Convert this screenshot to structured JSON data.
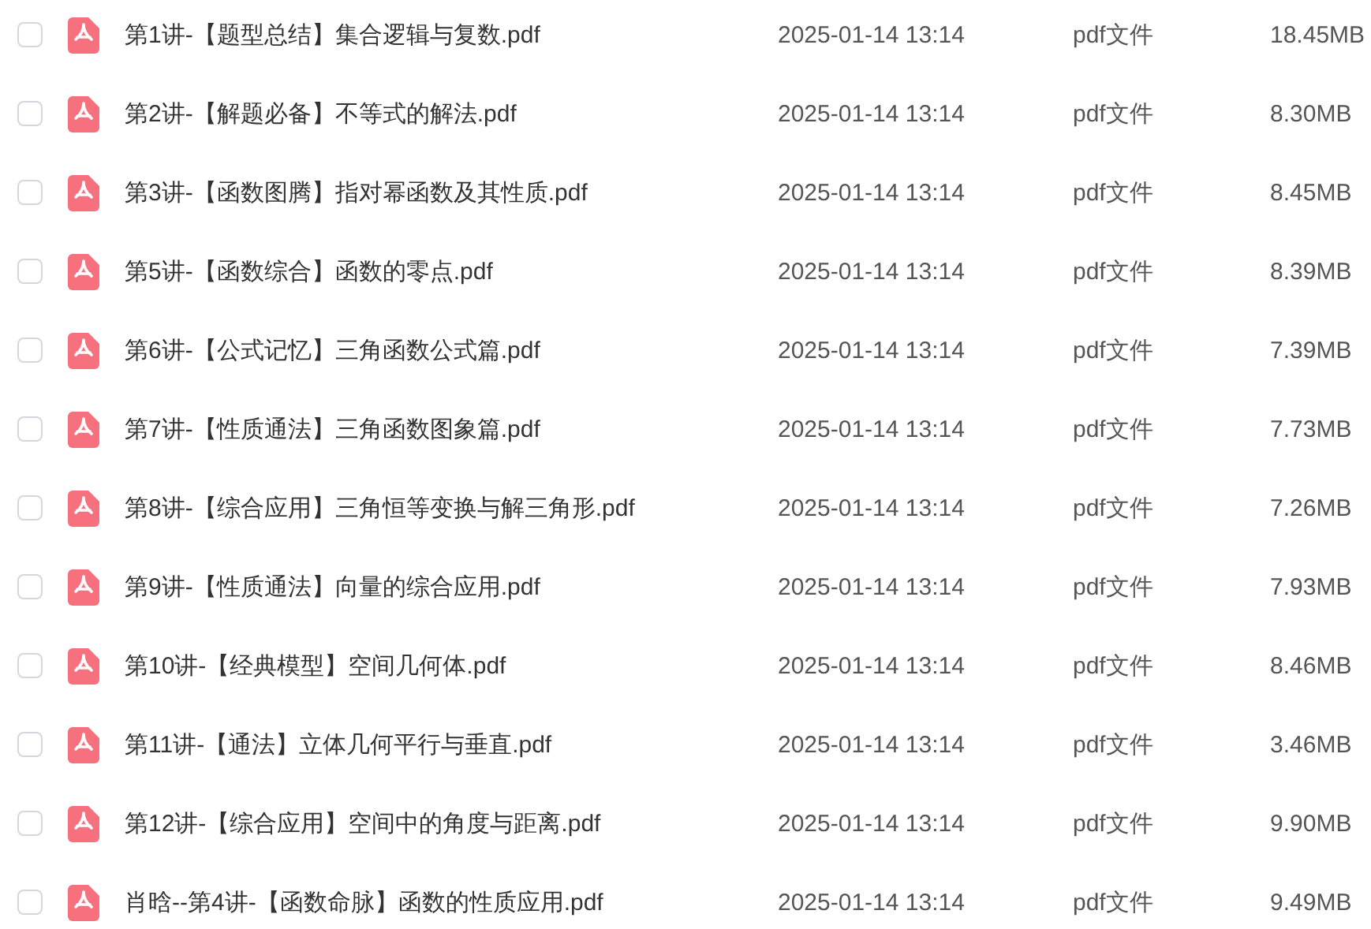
{
  "files": [
    {
      "name": "第1讲-【题型总结】集合逻辑与复数.pdf",
      "date": "2025-01-14 13:14",
      "type": "pdf文件",
      "size": "18.45MB",
      "checked": false
    },
    {
      "name": "第2讲-【解题必备】不等式的解法.pdf",
      "date": "2025-01-14 13:14",
      "type": "pdf文件",
      "size": "8.30MB",
      "checked": false
    },
    {
      "name": "第3讲-【函数图腾】指对幂函数及其性质.pdf",
      "date": "2025-01-14 13:14",
      "type": "pdf文件",
      "size": "8.45MB",
      "checked": false
    },
    {
      "name": "第5讲-【函数综合】函数的零点.pdf",
      "date": "2025-01-14 13:14",
      "type": "pdf文件",
      "size": "8.39MB",
      "checked": false
    },
    {
      "name": "第6讲-【公式记忆】三角函数公式篇.pdf",
      "date": "2025-01-14 13:14",
      "type": "pdf文件",
      "size": "7.39MB",
      "checked": false
    },
    {
      "name": "第7讲-【性质通法】三角函数图象篇.pdf",
      "date": "2025-01-14 13:14",
      "type": "pdf文件",
      "size": "7.73MB",
      "checked": false
    },
    {
      "name": "第8讲-【综合应用】三角恒等变换与解三角形.pdf",
      "date": "2025-01-14 13:14",
      "type": "pdf文件",
      "size": "7.26MB",
      "checked": false
    },
    {
      "name": "第9讲-【性质通法】向量的综合应用.pdf",
      "date": "2025-01-14 13:14",
      "type": "pdf文件",
      "size": "7.93MB",
      "checked": false
    },
    {
      "name": "第10讲-【经典模型】空间几何体.pdf",
      "date": "2025-01-14 13:14",
      "type": "pdf文件",
      "size": "8.46MB",
      "checked": false
    },
    {
      "name": "第11讲-【通法】立体几何平行与垂直.pdf",
      "date": "2025-01-14 13:14",
      "type": "pdf文件",
      "size": "3.46MB",
      "checked": false
    },
    {
      "name": "第12讲-【综合应用】空间中的角度与距离.pdf",
      "date": "2025-01-14 13:14",
      "type": "pdf文件",
      "size": "9.90MB",
      "checked": false
    },
    {
      "name": "肖晗--第4讲-【函数命脉】函数的性质应用.pdf",
      "date": "2025-01-14 13:14",
      "type": "pdf文件",
      "size": "9.49MB",
      "checked": false
    }
  ]
}
